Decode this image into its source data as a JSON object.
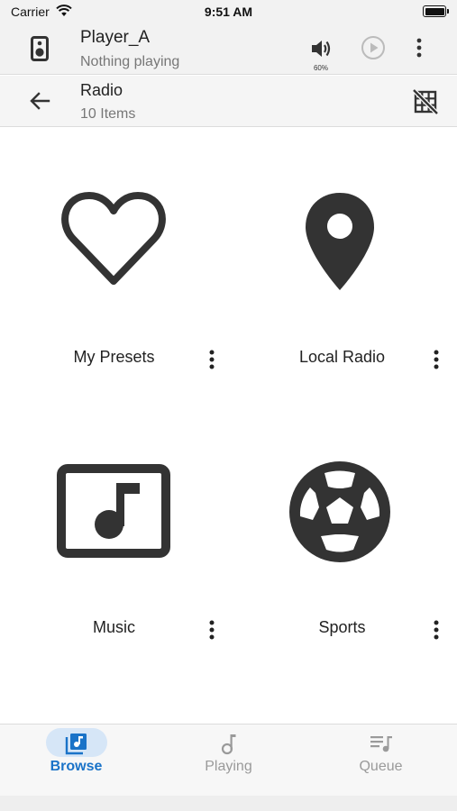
{
  "status_bar": {
    "carrier": "Carrier",
    "time": "9:51 AM"
  },
  "player": {
    "name": "Player_A",
    "status": "Nothing playing",
    "volume_label": "60%"
  },
  "nav": {
    "title": "Radio",
    "subtitle": "10 Items"
  },
  "items": [
    {
      "label": "My Presets",
      "icon": "heart-icon"
    },
    {
      "label": "Local Radio",
      "icon": "location-pin-icon"
    },
    {
      "label": "Music",
      "icon": "music-note-icon"
    },
    {
      "label": "Sports",
      "icon": "soccer-ball-icon"
    }
  ],
  "tabs": [
    {
      "label": "Browse",
      "icon": "browse-music-icon",
      "active": true
    },
    {
      "label": "Playing",
      "icon": "music-note-icon",
      "active": false
    },
    {
      "label": "Queue",
      "icon": "queue-music-icon",
      "active": false
    }
  ],
  "colors": {
    "accent": "#1a73c8",
    "icon_dark": "#333333",
    "inactive": "#9a9a9a"
  }
}
